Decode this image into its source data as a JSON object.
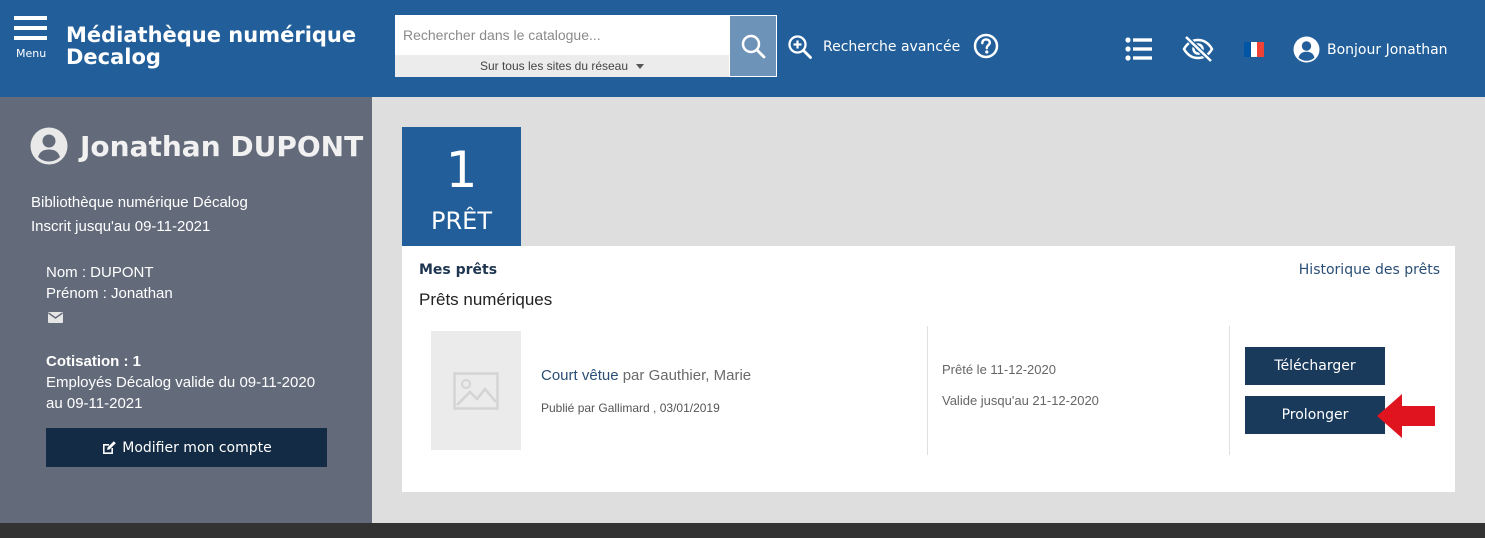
{
  "header": {
    "menu_label": "Menu",
    "brand_line1": "Médiathèque numérique",
    "brand_line2": "Decalog",
    "search_placeholder": "Rechercher dans le catalogue...",
    "search_scope": "Sur tous les sites du réseau",
    "advanced_search": "Recherche avancée",
    "greeting": "Bonjour Jonathan",
    "flag_colors": [
      "#0055a4",
      "#ffffff",
      "#ef4135"
    ]
  },
  "sidebar": {
    "user_name": "Jonathan DUPONT",
    "library": "Bibliothèque numérique Décalog",
    "registered_until": "Inscrit jusqu'au 09-11-2021",
    "nom": "Nom : DUPONT",
    "prenom": "Prénom : Jonathan",
    "cotisation_title": "Cotisation : 1",
    "cotisation_line1": "Employés Décalog valide du 09-11-2020",
    "cotisation_line2": "au 09-11-2021",
    "edit_button": "Modifier mon compte"
  },
  "loans_summary": {
    "count": "1",
    "label": "PRÊT"
  },
  "panel": {
    "my_loans": "Mes prêts",
    "history_link": "Historique des prêts",
    "section_title": "Prêts numériques",
    "loan": {
      "title": "Court vêtue",
      "by": "par Gauthier, Marie",
      "published": "Publié par Gallimard , 03/01/2019",
      "lent_on": "Prêté le 11-12-2020",
      "valid_until": "Valide jusqu'au 21-12-2020",
      "download_button": "Télécharger",
      "extend_button": "Prolonger"
    }
  },
  "colors": {
    "header_bg": "#225f9a",
    "sidebar_bg": "#636b7b",
    "button_bg": "#1a3a5c",
    "arrow": "#e0141e"
  }
}
